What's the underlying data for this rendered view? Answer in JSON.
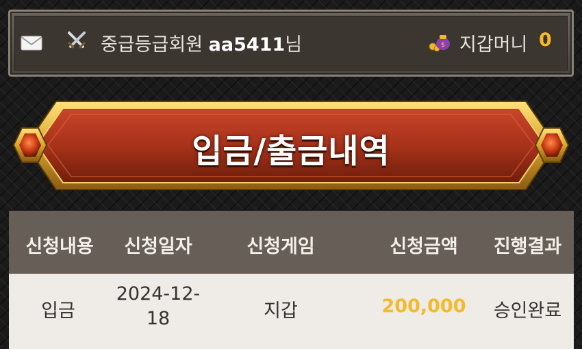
{
  "topbar": {
    "mail_icon": "mail-icon",
    "rank_icon": "crossed-swords-icon",
    "member_grade": "중급등급회원",
    "username": "aa5411",
    "honorific": "님",
    "wallet_icon": "money-bag-icon",
    "wallet_label": "지갑머니",
    "wallet_amount": "0"
  },
  "banner": {
    "title": "입금/출금내역"
  },
  "table": {
    "headers": [
      "신청내용",
      "신청일자",
      "신청게임",
      "신청금액",
      "진행결과"
    ],
    "rows": [
      {
        "type": "입금",
        "date_line1": "2024-12-",
        "date_line2": "18",
        "game": "지갑",
        "amount": "200,000",
        "result": "승인완료"
      }
    ]
  },
  "colors": {
    "accent_gold": "#f6b92a",
    "banner_red": "#a8321a",
    "header_bg": "#675f57",
    "row_bg": "#efebe6"
  }
}
